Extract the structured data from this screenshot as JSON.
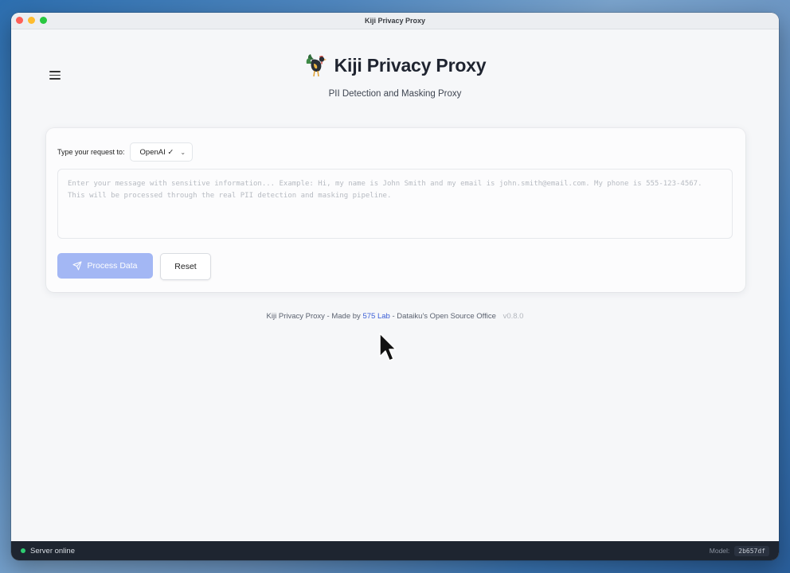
{
  "window": {
    "title": "Kiji Privacy Proxy"
  },
  "header": {
    "title": "Kiji Privacy Proxy",
    "subtitle": "PII Detection and Masking Proxy",
    "logo_icon": "rooster-logo-icon"
  },
  "form": {
    "provider_label": "Type your request to:",
    "provider_selected": "OpenAI ✓",
    "message_value": "",
    "message_placeholder": "Enter your message with sensitive information... Example: Hi, my name is John Smith and my email is john.smith@email.com. My phone is 555-123-4567. This will be processed through the real PII detection and masking pipeline.",
    "process_button": "Process Data",
    "reset_button": "Reset"
  },
  "footer": {
    "prefix": "Kiji Privacy Proxy - Made by",
    "link": "575 Lab",
    "suffix": "- Dataiku's Open Source Office",
    "version": "v0.8.0"
  },
  "statusbar": {
    "status": "Server online",
    "model_label": "Model:",
    "model_value": "2b657df"
  },
  "colors": {
    "primary_button": "#a3b7f4",
    "status_online": "#2ecc71",
    "link": "#3b5ed6",
    "statusbar_bg": "#1e2530"
  }
}
